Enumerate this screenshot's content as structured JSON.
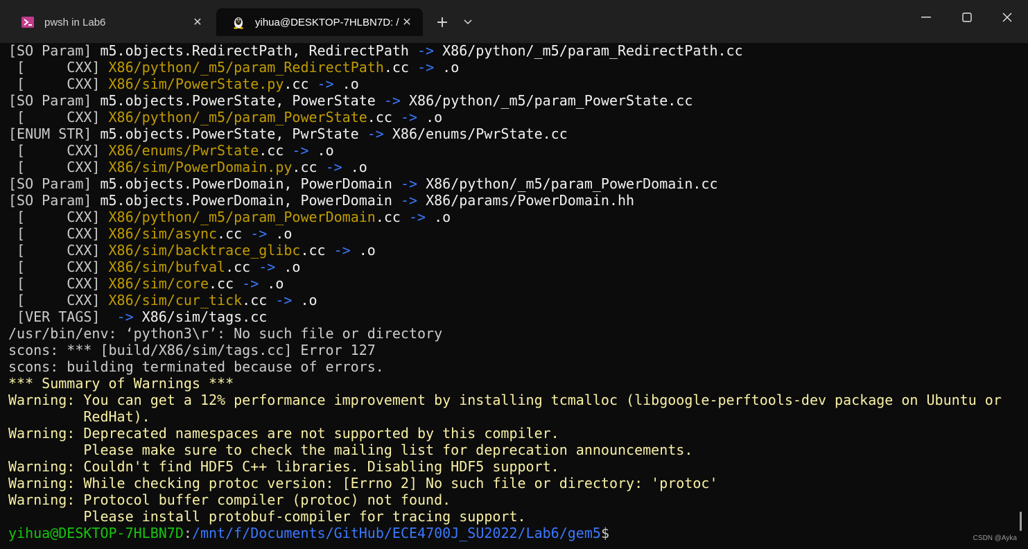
{
  "tabs": [
    {
      "label": "pwsh in Lab6",
      "icon": "powershell-icon",
      "close": "✕"
    },
    {
      "label": "yihua@DESKTOP-7HLBN7D: /",
      "icon": "linux-penguin-icon",
      "close": "✕"
    }
  ],
  "tab_controls": {
    "new_tab": "+",
    "dropdown": "⌄"
  },
  "window_controls": {
    "minimize": "—",
    "maximize": "☐",
    "close": "✕"
  },
  "colors": {
    "background": "#0c0c0c",
    "titlebar": "#202020",
    "yellow": "#c19c00",
    "blue": "#3b78ff",
    "green": "#16c60c",
    "warning": "#f9f1a5"
  },
  "terminal_lines": [
    [
      {
        "t": "[SO Param] ",
        "c": "norm"
      },
      {
        "t": "m5.objects.RedirectPath, RedirectPath ",
        "c": "bold"
      },
      {
        "t": "-> ",
        "c": "blue"
      },
      {
        "t": "X86/python/_m5/param_RedirectPath.cc",
        "c": "bold"
      }
    ],
    [
      {
        "t": " [     CXX] ",
        "c": "norm"
      },
      {
        "t": "X86/python/_m5/param_RedirectPath",
        "c": "yellow"
      },
      {
        "t": ".cc ",
        "c": "bold"
      },
      {
        "t": "-> ",
        "c": "blue"
      },
      {
        "t": ".o",
        "c": "bold"
      }
    ],
    [
      {
        "t": " [     CXX] ",
        "c": "norm"
      },
      {
        "t": "X86/sim/PowerState.py",
        "c": "yellow"
      },
      {
        "t": ".cc ",
        "c": "bold"
      },
      {
        "t": "-> ",
        "c": "blue"
      },
      {
        "t": ".o",
        "c": "bold"
      }
    ],
    [
      {
        "t": "[SO Param] ",
        "c": "norm"
      },
      {
        "t": "m5.objects.PowerState, PowerState ",
        "c": "bold"
      },
      {
        "t": "-> ",
        "c": "blue"
      },
      {
        "t": "X86/python/_m5/param_PowerState.cc",
        "c": "bold"
      }
    ],
    [
      {
        "t": " [     CXX] ",
        "c": "norm"
      },
      {
        "t": "X86/python/_m5/param_PowerState",
        "c": "yellow"
      },
      {
        "t": ".cc ",
        "c": "bold"
      },
      {
        "t": "-> ",
        "c": "blue"
      },
      {
        "t": ".o",
        "c": "bold"
      }
    ],
    [
      {
        "t": "[ENUM STR] ",
        "c": "norm"
      },
      {
        "t": "m5.objects.PowerState, PwrState ",
        "c": "bold"
      },
      {
        "t": "-> ",
        "c": "blue"
      },
      {
        "t": "X86/enums/PwrState.cc",
        "c": "bold"
      }
    ],
    [
      {
        "t": " [     CXX] ",
        "c": "norm"
      },
      {
        "t": "X86/enums/PwrState",
        "c": "yellow"
      },
      {
        "t": ".cc ",
        "c": "bold"
      },
      {
        "t": "-> ",
        "c": "blue"
      },
      {
        "t": ".o",
        "c": "bold"
      }
    ],
    [
      {
        "t": " [     CXX] ",
        "c": "norm"
      },
      {
        "t": "X86/sim/PowerDomain.py",
        "c": "yellow"
      },
      {
        "t": ".cc ",
        "c": "bold"
      },
      {
        "t": "-> ",
        "c": "blue"
      },
      {
        "t": ".o",
        "c": "bold"
      }
    ],
    [
      {
        "t": "[SO Param] ",
        "c": "norm"
      },
      {
        "t": "m5.objects.PowerDomain, PowerDomain ",
        "c": "bold"
      },
      {
        "t": "-> ",
        "c": "blue"
      },
      {
        "t": "X86/python/_m5/param_PowerDomain.cc",
        "c": "bold"
      }
    ],
    [
      {
        "t": "[SO Param] ",
        "c": "norm"
      },
      {
        "t": "m5.objects.PowerDomain, PowerDomain ",
        "c": "bold"
      },
      {
        "t": "-> ",
        "c": "blue"
      },
      {
        "t": "X86/params/PowerDomain.hh",
        "c": "bold"
      }
    ],
    [
      {
        "t": " [     CXX] ",
        "c": "norm"
      },
      {
        "t": "X86/python/_m5/param_PowerDomain",
        "c": "yellow"
      },
      {
        "t": ".cc ",
        "c": "bold"
      },
      {
        "t": "-> ",
        "c": "blue"
      },
      {
        "t": ".o",
        "c": "bold"
      }
    ],
    [
      {
        "t": " [     CXX] ",
        "c": "norm"
      },
      {
        "t": "X86/sim/async",
        "c": "yellow"
      },
      {
        "t": ".cc ",
        "c": "bold"
      },
      {
        "t": "-> ",
        "c": "blue"
      },
      {
        "t": ".o",
        "c": "bold"
      }
    ],
    [
      {
        "t": " [     CXX] ",
        "c": "norm"
      },
      {
        "t": "X86/sim/backtrace_glibc",
        "c": "yellow"
      },
      {
        "t": ".cc ",
        "c": "bold"
      },
      {
        "t": "-> ",
        "c": "blue"
      },
      {
        "t": ".o",
        "c": "bold"
      }
    ],
    [
      {
        "t": " [     CXX] ",
        "c": "norm"
      },
      {
        "t": "X86/sim/bufval",
        "c": "yellow"
      },
      {
        "t": ".cc ",
        "c": "bold"
      },
      {
        "t": "-> ",
        "c": "blue"
      },
      {
        "t": ".o",
        "c": "bold"
      }
    ],
    [
      {
        "t": " [     CXX] ",
        "c": "norm"
      },
      {
        "t": "X86/sim/core",
        "c": "yellow"
      },
      {
        "t": ".cc ",
        "c": "bold"
      },
      {
        "t": "-> ",
        "c": "blue"
      },
      {
        "t": ".o",
        "c": "bold"
      }
    ],
    [
      {
        "t": " [     CXX] ",
        "c": "norm"
      },
      {
        "t": "X86/sim/cur_tick",
        "c": "yellow"
      },
      {
        "t": ".cc ",
        "c": "bold"
      },
      {
        "t": "-> ",
        "c": "blue"
      },
      {
        "t": ".o",
        "c": "bold"
      }
    ],
    [
      {
        "t": " [VER TAGS]  ",
        "c": "norm"
      },
      {
        "t": "-> ",
        "c": "blue"
      },
      {
        "t": "X86/sim/tags.cc",
        "c": "bold"
      }
    ],
    [
      {
        "t": "/usr/bin/env: ‘python3\\r’: No such file or directory",
        "c": "norm"
      }
    ],
    [
      {
        "t": "scons: *** [build/X86/sim/tags.cc] Error 127",
        "c": "norm"
      }
    ],
    [
      {
        "t": "scons: building terminated because of errors.",
        "c": "norm"
      }
    ],
    [
      {
        "t": "*** Summary of Warnings ***",
        "c": "warn"
      }
    ],
    [
      {
        "t": "Warning: You can get a 12% performance improvement by installing tcmalloc (libgoogle-perftools-dev package on Ubuntu or",
        "c": "warn"
      }
    ],
    [
      {
        "t": "         RedHat).",
        "c": "warn"
      }
    ],
    [
      {
        "t": "Warning: Deprecated namespaces are not supported by this compiler.",
        "c": "warn"
      }
    ],
    [
      {
        "t": "         Please make sure to check the mailing list for deprecation announcements.",
        "c": "warn"
      }
    ],
    [
      {
        "t": "Warning: Couldn't find HDF5 C++ libraries. Disabling HDF5 support.",
        "c": "warn"
      }
    ],
    [
      {
        "t": "Warning: While checking protoc version: [Errno 2] No such file or directory: 'protoc'",
        "c": "warn"
      }
    ],
    [
      {
        "t": "Warning: Protocol buffer compiler (protoc) not found.",
        "c": "warn"
      }
    ],
    [
      {
        "t": "         Please install protobuf-compiler for tracing support.",
        "c": "warn"
      }
    ],
    [
      {
        "t": "yihua@DESKTOP-7HLBN7D",
        "c": "green"
      },
      {
        "t": ":",
        "c": "norm"
      },
      {
        "t": "/mnt/f/Documents/GitHub/ECE4700J_SU2022/Lab6/gem5",
        "c": "path"
      },
      {
        "t": "$",
        "c": "norm"
      }
    ]
  ],
  "watermark": "CSDN @Ayka"
}
